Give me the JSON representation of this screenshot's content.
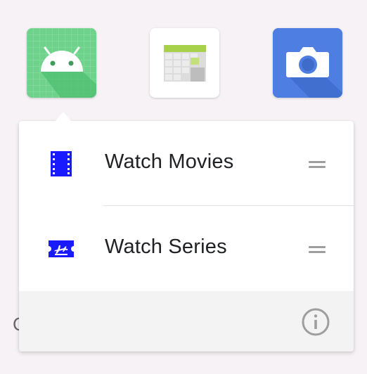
{
  "apps": [
    {
      "name": "android-app",
      "icon": "android-icon",
      "bg": "#6fd28b"
    },
    {
      "name": "calendar-app",
      "icon": "calendar-icon",
      "bg": "#ffffff"
    },
    {
      "name": "camera-app",
      "icon": "camera-icon",
      "bg": "#4e7ee2"
    }
  ],
  "behind_text": "C",
  "popup": {
    "shortcuts": [
      {
        "label": "Watch Movies",
        "icon": "film-icon",
        "handle_icon": "drag-handle-icon"
      },
      {
        "label": "Watch Series",
        "icon": "ticket-icon",
        "handle_icon": "drag-handle-icon"
      }
    ],
    "footer": {
      "info_icon": "info-icon"
    }
  },
  "colors": {
    "background": "#f7f2f5",
    "shortcut_icon": "#1a1aff",
    "label_text": "#202124",
    "handle": "#9e9e9e",
    "footer_bg": "#f3f3f3"
  }
}
